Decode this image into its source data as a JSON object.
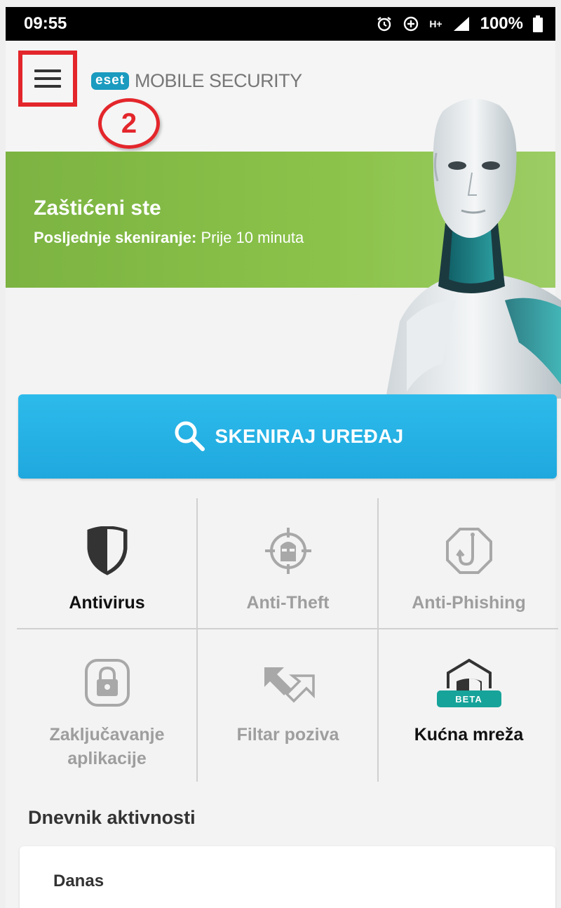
{
  "status_bar": {
    "time": "09:55",
    "network": "H+",
    "battery": "100%",
    "icons": [
      "alarm-icon",
      "data-saver-icon",
      "network-hplus-icon",
      "signal-icon",
      "battery-icon"
    ]
  },
  "app_bar": {
    "logo_badge": "eset",
    "logo_text": "MOBILE SECURITY",
    "step_marker": "2"
  },
  "banner": {
    "title": "Zaštićeni ste",
    "scan_label": "Posljednje skeniranje:",
    "scan_value": "Prije 10 minuta"
  },
  "scan_button": {
    "label": "SKENIRAJ UREĐAJ"
  },
  "features": [
    {
      "label": "Antivirus",
      "icon": "shield-icon",
      "active": true
    },
    {
      "label": "Anti-Theft",
      "icon": "anti-theft-icon",
      "active": false
    },
    {
      "label": "Anti-Phishing",
      "icon": "phishing-hook-icon",
      "active": false
    },
    {
      "label": "Zaključavanje aplikacije",
      "icon": "padlock-icon",
      "active": false
    },
    {
      "label": "Filtar poziva",
      "icon": "call-filter-icon",
      "active": false
    },
    {
      "label": "Kućna mreža",
      "icon": "home-network-icon",
      "active": true,
      "badge": "BETA"
    }
  ],
  "activity": {
    "title": "Dnevnik aktivnosti",
    "today": "Danas"
  },
  "colors": {
    "green": "#8bc34a",
    "blue": "#29b6e8",
    "highlight_red": "#e3262b",
    "beta_teal": "#16a39a",
    "eset_blue": "#1a9bbf"
  }
}
